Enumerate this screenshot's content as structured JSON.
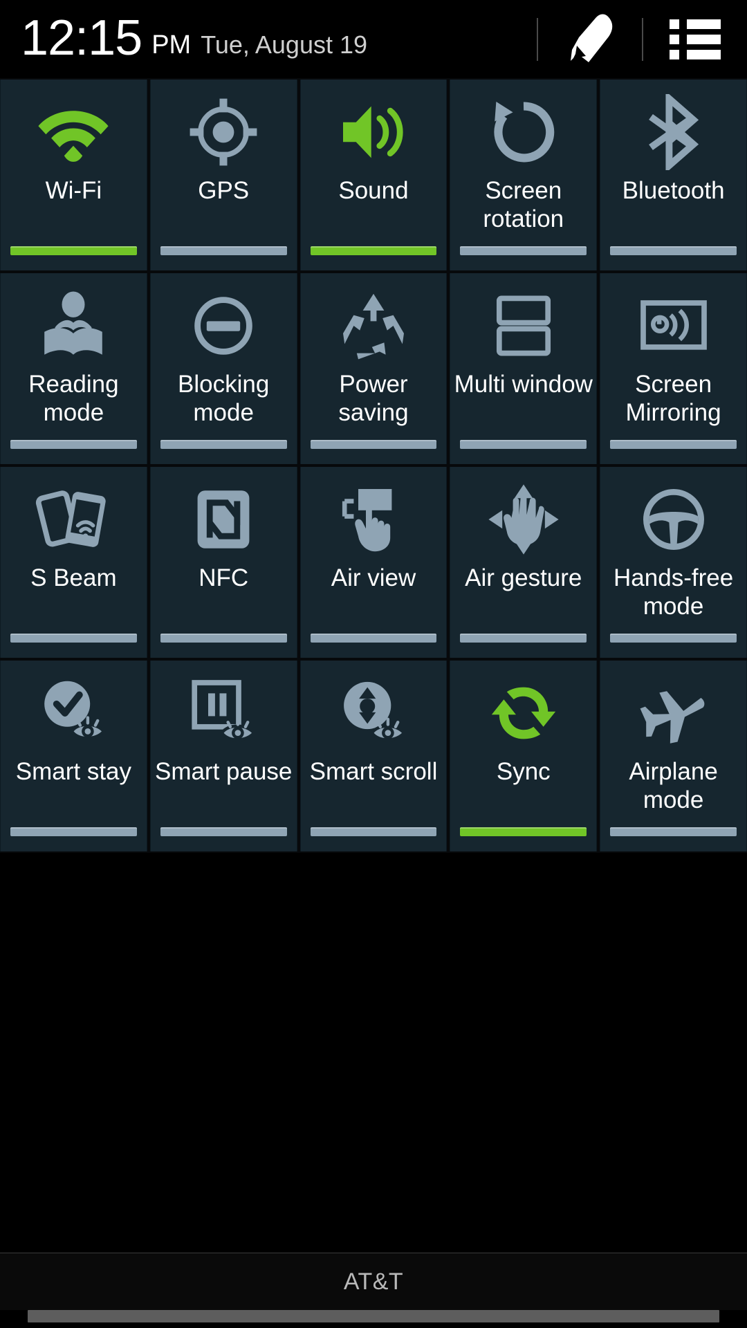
{
  "status_bar": {
    "time": "12:15",
    "ampm": "PM",
    "date": "Tue, August 19",
    "edit_icon": "pencil-icon",
    "list_icon": "list-icon"
  },
  "colors": {
    "accent_on": "#71c527",
    "indicator_off": "#8fa4b4",
    "tile_background": "#16262f",
    "panel_background": "#000000",
    "label_text": "#ffffff"
  },
  "quick_settings": {
    "columns": 5,
    "rows": 4,
    "tiles": [
      {
        "label": "Wi-Fi",
        "icon": "wifi-icon",
        "state": "on"
      },
      {
        "label": "GPS",
        "icon": "gps-icon",
        "state": "off"
      },
      {
        "label": "Sound",
        "icon": "sound-icon",
        "state": "on"
      },
      {
        "label": "Screen rotation",
        "icon": "screen-rotation-icon",
        "state": "off"
      },
      {
        "label": "Bluetooth",
        "icon": "bluetooth-icon",
        "state": "off"
      },
      {
        "label": "Reading mode",
        "icon": "reading-mode-icon",
        "state": "off"
      },
      {
        "label": "Blocking mode",
        "icon": "blocking-mode-icon",
        "state": "off"
      },
      {
        "label": "Power saving",
        "icon": "power-saving-icon",
        "state": "off"
      },
      {
        "label": "Multi window",
        "icon": "multi-window-icon",
        "state": "off"
      },
      {
        "label": "Screen Mirroring",
        "icon": "screen-mirroring-icon",
        "state": "off"
      },
      {
        "label": "S Beam",
        "icon": "s-beam-icon",
        "state": "off"
      },
      {
        "label": "NFC",
        "icon": "nfc-icon",
        "state": "off"
      },
      {
        "label": "Air view",
        "icon": "air-view-icon",
        "state": "off"
      },
      {
        "label": "Air gesture",
        "icon": "air-gesture-icon",
        "state": "off"
      },
      {
        "label": "Hands-free mode",
        "icon": "hands-free-mode-icon",
        "state": "off"
      },
      {
        "label": "Smart stay",
        "icon": "smart-stay-icon",
        "state": "off"
      },
      {
        "label": "Smart pause",
        "icon": "smart-pause-icon",
        "state": "off"
      },
      {
        "label": "Smart scroll",
        "icon": "smart-scroll-icon",
        "state": "off"
      },
      {
        "label": "Sync",
        "icon": "sync-icon",
        "state": "on"
      },
      {
        "label": "Airplane mode",
        "icon": "airplane-mode-icon",
        "state": "off"
      }
    ]
  },
  "footer": {
    "carrier": "AT&T"
  }
}
